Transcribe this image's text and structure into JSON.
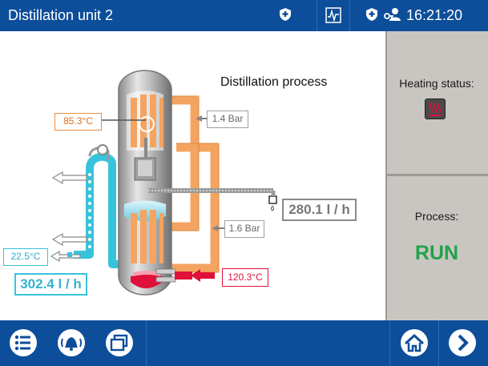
{
  "header": {
    "title": "Distillation unit 2",
    "time": "16:21:20",
    "icons": [
      "alarm-shield-icon",
      "trend-chart-icon",
      "alarm-shield-icon",
      "user-key-icon"
    ]
  },
  "diagram": {
    "title": "Distillation process",
    "top_temperature": "85.3°C",
    "top_pressure": "1.4 Bar",
    "mid_pressure": "1.6 Bar",
    "distillate_flow": "280.1 l / h",
    "cooling_temperature": "22.5°C",
    "cooling_flow": "302.4 l / h",
    "heating_temperature": "120.3°C"
  },
  "side_panel": {
    "heating_status_label": "Heating status:",
    "process_label": "Process:",
    "process_state": "RUN"
  },
  "footer": {
    "buttons": [
      "menu-icon",
      "alarm-bell-icon",
      "windows-icon",
      "home-icon",
      "next-icon"
    ]
  },
  "colors": {
    "header_bg": "#0d4e9a",
    "orange_pipe": "#f4a460",
    "cyan_pipe": "#37c3dc",
    "run": "#22a34a",
    "heating": "#e0103a"
  }
}
